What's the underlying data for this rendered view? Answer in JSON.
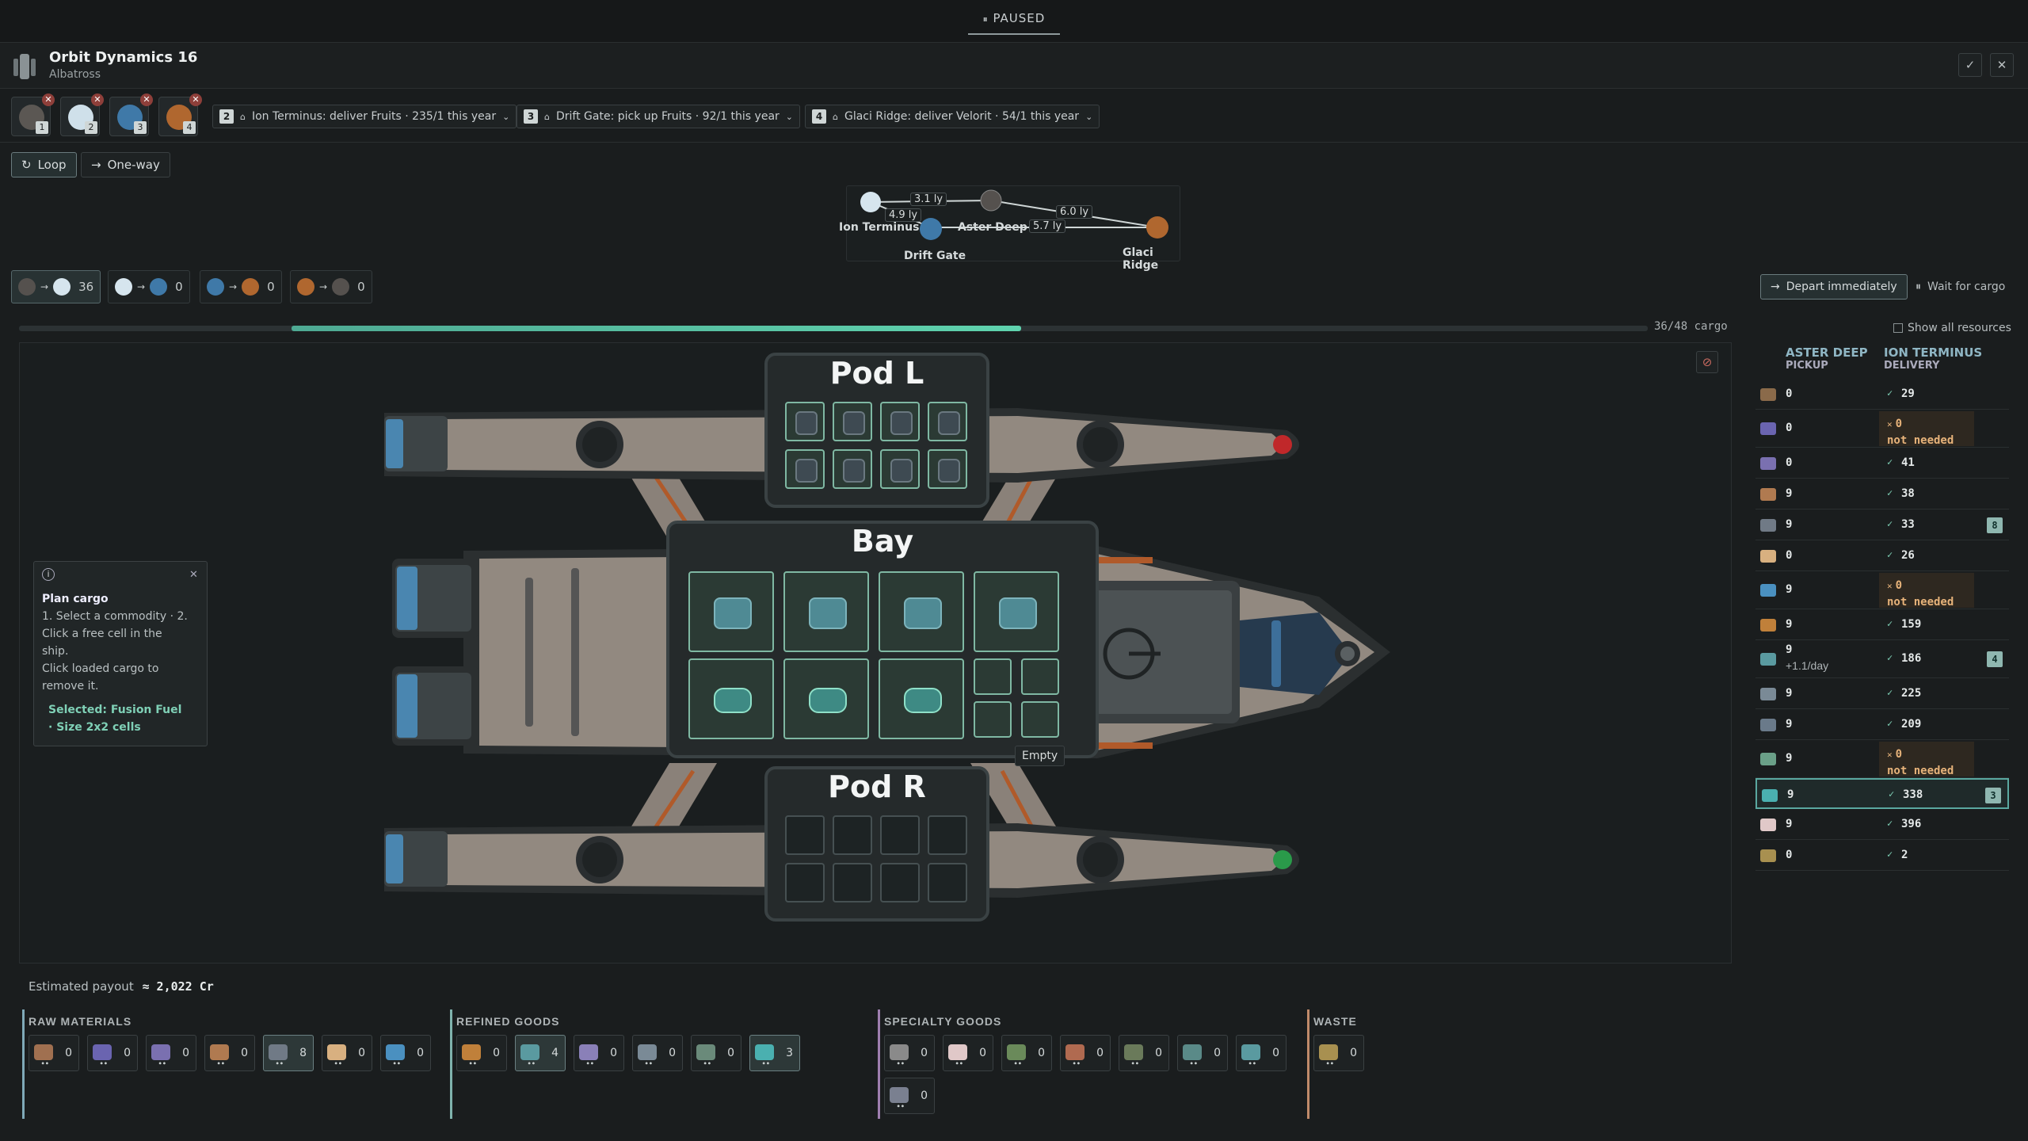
{
  "status": {
    "paused": "PAUSED"
  },
  "ship": {
    "name": "Orbit Dynamics 16",
    "class": "Albatross"
  },
  "window": {
    "confirm_icon": "check-icon",
    "close_icon": "close-icon"
  },
  "stops": [
    {
      "num": "1",
      "color": "#5b5753"
    },
    {
      "num": "2",
      "color": "#cfe0ea"
    },
    {
      "num": "3",
      "color": "#3f79a8"
    },
    {
      "num": "4",
      "color": "#b0672f"
    }
  ],
  "orders": [
    {
      "num": "2",
      "text": "Ion Terminus: deliver Fruits · 235/1 this year"
    },
    {
      "num": "3",
      "text": "Drift Gate: pick up Fruits · 92/1 this year"
    },
    {
      "num": "4",
      "text": "Glaci Ridge: deliver Velorit · 54/1 this year"
    }
  ],
  "route_mode": {
    "loop": "Loop",
    "oneway": "One-way"
  },
  "map": {
    "nodes": [
      {
        "name": "Ion Terminus",
        "num": "2"
      },
      {
        "name": "Aster Deep",
        "num": "1"
      },
      {
        "name": "Drift Gate",
        "num": "3"
      },
      {
        "name": "Glaci Ridge",
        "num": "4"
      }
    ],
    "edges": [
      "3.1 ly",
      "4.9 ly",
      "6.0 ly",
      "5.7 ly"
    ]
  },
  "legs": [
    {
      "count": "36"
    },
    {
      "count": "0"
    },
    {
      "count": "0"
    },
    {
      "count": "0"
    }
  ],
  "departure": {
    "depart": "Depart immediately",
    "wait": "Wait for cargo"
  },
  "cargo": {
    "text": "36/48 cargo",
    "filled": 36,
    "capacity": 48
  },
  "pods": {
    "left": "Pod L",
    "bay": "Bay",
    "right": "Pod R"
  },
  "tooltip_empty": "Empty",
  "plan_card": {
    "title": "Plan cargo",
    "line1": "1. Select a commodity · 2.",
    "line2": "Click a free cell in the",
    "line3": "ship.",
    "line4": "Click loaded cargo to",
    "line5": "remove it.",
    "sel1": "Selected: Fusion Fuel",
    "sel2": "· Size 2x2 cells"
  },
  "right": {
    "show_all": "Show all resources",
    "col1_title": "ASTER DEEP",
    "col1_sub": "PICKUP",
    "col2_title": "ION TERMINUS",
    "col2_sub": "DELIVERY",
    "rows": [
      {
        "pickup": "0",
        "delivery": "29",
        "ok": true,
        "color": "#8a6a4a"
      },
      {
        "pickup": "0",
        "delivery": "0",
        "ok": false,
        "note": "not needed",
        "color": "#6a64b0"
      },
      {
        "pickup": "0",
        "delivery": "41",
        "ok": true,
        "color": "#7a70b0"
      },
      {
        "pickup": "9",
        "delivery": "38",
        "ok": true,
        "color": "#b07a50"
      },
      {
        "pickup": "9",
        "delivery": "33",
        "ok": true,
        "badge": "8",
        "color": "#707a86"
      },
      {
        "pickup": "0",
        "delivery": "26",
        "ok": true,
        "color": "#d8b080"
      },
      {
        "pickup": "9",
        "delivery": "0",
        "ok": false,
        "note": "not needed",
        "color": "#4a90c0"
      },
      {
        "pickup": "9",
        "delivery": "159",
        "ok": true,
        "color": "#c0803a"
      },
      {
        "pickup": "9",
        "pickup_note": "+1.1/day",
        "delivery": "186",
        "ok": true,
        "badge": "4",
        "color": "#5a9aa0"
      },
      {
        "pickup": "9",
        "delivery": "225",
        "ok": true,
        "color": "#7a8a96"
      },
      {
        "pickup": "9",
        "delivery": "209",
        "ok": true,
        "color": "#6a7a8a"
      },
      {
        "pickup": "9",
        "delivery": "0",
        "ok": false,
        "note": "not needed",
        "color": "#6aa088"
      },
      {
        "pickup": "9",
        "delivery": "338",
        "ok": true,
        "badge": "3",
        "color": "#4ab0b0",
        "selected": true
      },
      {
        "pickup": "9",
        "delivery": "396",
        "ok": true,
        "color": "#e0c8c8"
      },
      {
        "pickup": "0",
        "delivery": "2",
        "ok": true,
        "color": "#a89050"
      }
    ]
  },
  "payout": {
    "label": "Estimated payout",
    "value": "≈ 2,022 Cr"
  },
  "categories": [
    {
      "name": "RAW MATERIALS",
      "accent": "#7fa9b8",
      "items": [
        {
          "q": "0",
          "color": "#a07050"
        },
        {
          "q": "0",
          "color": "#6a64b0"
        },
        {
          "q": "0",
          "color": "#7a70b0"
        },
        {
          "q": "0",
          "color": "#b07a50"
        },
        {
          "q": "8",
          "color": "#707a86",
          "sel": true
        },
        {
          "q": "0",
          "color": "#d8b080"
        },
        {
          "q": "0",
          "color": "#4a90c0"
        }
      ]
    },
    {
      "name": "REFINED GOODS",
      "accent": "#7fb3ad",
      "items": [
        {
          "q": "0",
          "color": "#c0803a"
        },
        {
          "q": "4",
          "color": "#5a9aa0",
          "sel": true
        },
        {
          "q": "0",
          "color": "#8a80b8"
        },
        {
          "q": "0",
          "color": "#7a8a96"
        },
        {
          "q": "0",
          "color": "#6a8a7a"
        },
        {
          "q": "3",
          "color": "#4ab0b0",
          "sel": true
        }
      ]
    },
    {
      "name": "SPECIALTY GOODS",
      "accent": "#9f7fb0",
      "items": [
        {
          "q": "0",
          "color": "#8a8a8a"
        },
        {
          "q": "0",
          "color": "#e0c8c8"
        },
        {
          "q": "0",
          "color": "#6a8a5a"
        },
        {
          "q": "0",
          "color": "#b06a50"
        },
        {
          "q": "0",
          "color": "#6a7a5a"
        },
        {
          "q": "0",
          "color": "#5a8a88"
        },
        {
          "q": "0",
          "color": "#5a9aa0"
        },
        {
          "q": "0",
          "color": "#7a8090"
        }
      ]
    },
    {
      "name": "WASTE",
      "accent": "#c08a6a",
      "items": [
        {
          "q": "0",
          "color": "#a89050"
        }
      ]
    }
  ]
}
